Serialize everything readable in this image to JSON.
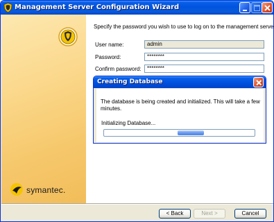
{
  "window": {
    "title": "Management Server Configuration Wizard"
  },
  "sidebar": {
    "logo_text": "symantec."
  },
  "content": {
    "instruction": "Specify the password you wish to use to log on to the management server.",
    "fields": [
      {
        "label": "User name:",
        "value": "admin"
      },
      {
        "label": "Password:",
        "value": "********"
      },
      {
        "label": "Confirm password:",
        "value": "********"
      }
    ]
  },
  "dialog": {
    "title": "Creating Database",
    "message": "The database is being created and initialized. This will take a few minutes.",
    "status": "Initializing Database..."
  },
  "buttons": {
    "back": "< Back",
    "next": "Next >",
    "cancel": "Cancel"
  },
  "colors": {
    "titlebar": "#0053e1",
    "sidebar": "#fbd98e",
    "close_button": "#e0502a"
  }
}
